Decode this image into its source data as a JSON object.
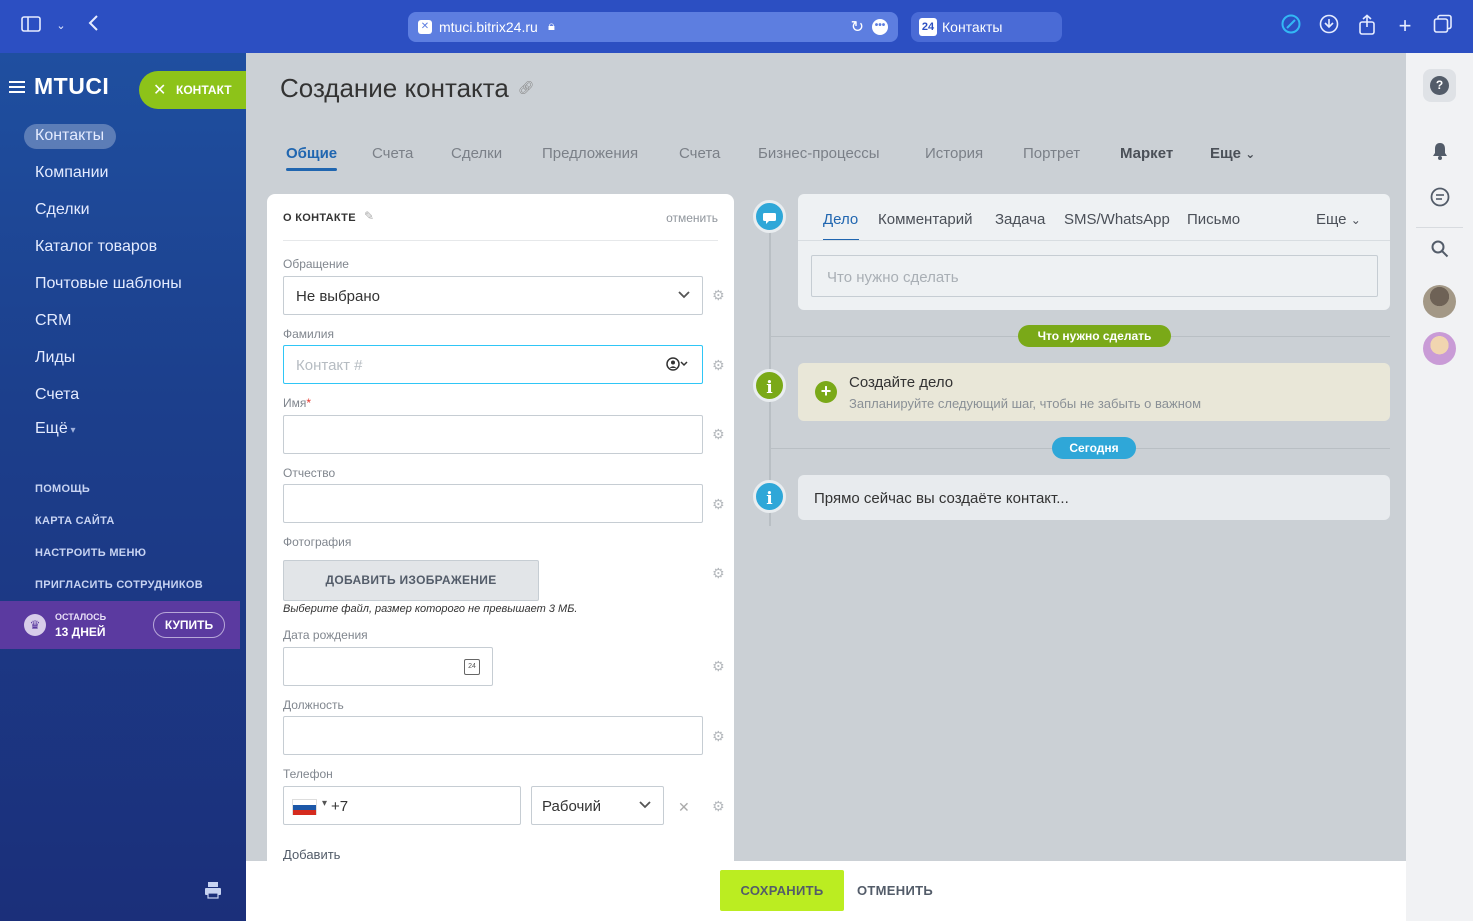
{
  "browser": {
    "url": "mtuci.bitrix24.ru",
    "tab_title": "Контакты",
    "tab_favicon": "24"
  },
  "sidebar": {
    "logo": "MTUCI",
    "contact_button": "КОНТАКТ",
    "items": [
      {
        "label": "Контакты",
        "active": true
      },
      {
        "label": "Компании"
      },
      {
        "label": "Сделки"
      },
      {
        "label": "Каталог товаров"
      },
      {
        "label": "Почтовые шаблоны"
      },
      {
        "label": "CRM"
      },
      {
        "label": "Лиды"
      },
      {
        "label": "Счета"
      },
      {
        "label": "Ещё"
      }
    ],
    "links": [
      "ПОМОЩЬ",
      "КАРТА САЙТА",
      "НАСТРОИТЬ МЕНЮ",
      "ПРИГЛАСИТЬ СОТРУДНИКОВ"
    ],
    "trial": {
      "line1": "ОСТАЛОСЬ",
      "line2": "13 ДНЕЙ",
      "buy": "КУПИТЬ"
    }
  },
  "page": {
    "title": "Создание контакта",
    "tabs": [
      "Общие",
      "Счета",
      "Сделки",
      "Предложения",
      "Счета",
      "Бизнес-процессы",
      "История",
      "Портрет",
      "Маркет",
      "Еще"
    ]
  },
  "form": {
    "header": "О КОНТАКТЕ",
    "cancel": "отменить",
    "salutation": {
      "label": "Обращение",
      "value": "Не выбрано"
    },
    "last_name": {
      "label": "Фамилия",
      "placeholder": "Контакт #"
    },
    "first_name": {
      "label": "Имя",
      "required": "*"
    },
    "middle_name": {
      "label": "Отчество"
    },
    "photo": {
      "label": "Фотография",
      "button": "ДОБАВИТЬ ИЗОБРАЖЕНИЕ",
      "hint": "Выберите файл, размер которого не превышает 3 МБ."
    },
    "birthday": {
      "label": "Дата рождения",
      "calendar_day": "24"
    },
    "position": {
      "label": "Должность"
    },
    "phone": {
      "label": "Телефон",
      "value": "+7",
      "type": "Рабочий"
    },
    "add": "Добавить"
  },
  "activity": {
    "tabs": [
      "Дело",
      "Комментарий",
      "Задача",
      "SMS/WhatsApp",
      "Письмо",
      "Еще"
    ],
    "input_placeholder": "Что нужно сделать",
    "todo_badge": "Что нужно сделать",
    "create_title": "Создайте дело",
    "create_subtitle": "Запланируйте следующий шаг, чтобы не забыть о важном",
    "today_badge": "Сегодня",
    "now_text": "Прямо сейчас вы создаёте контакт..."
  },
  "bottom": {
    "save": "СОХРАНИТЬ",
    "cancel": "ОТМЕНИТЬ"
  },
  "colors": {
    "accent_blue": "#2066b0",
    "green": "#8dc319",
    "save_green": "#bbed21",
    "timeline_blue": "#2fa7d8"
  }
}
